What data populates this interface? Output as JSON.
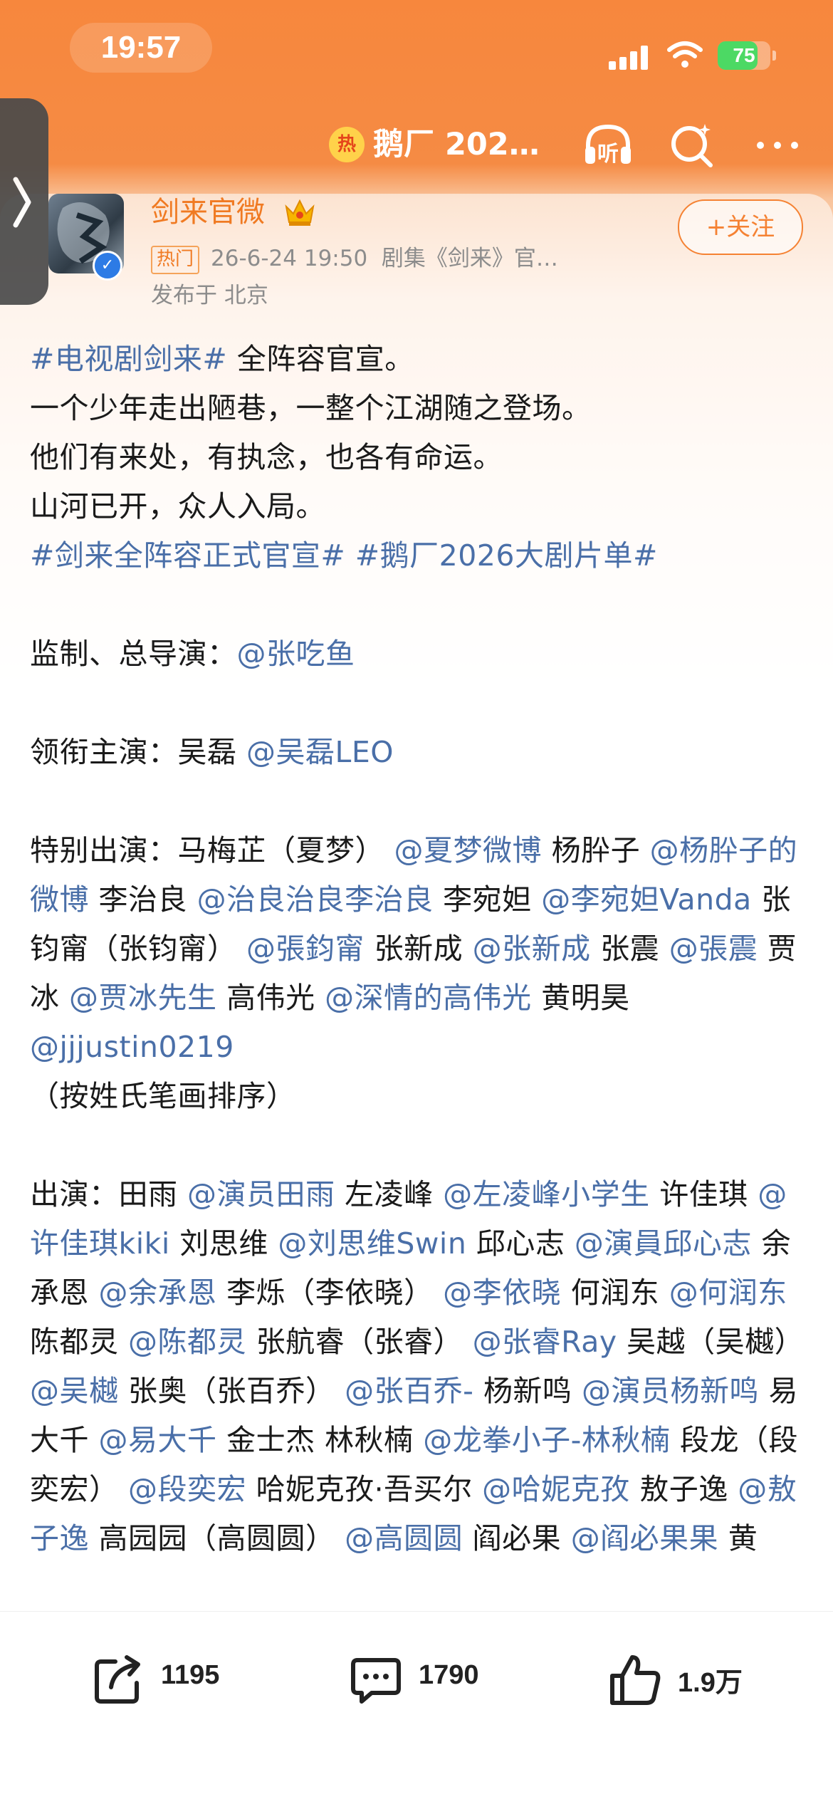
{
  "status_bar": {
    "time": "19:57",
    "battery": "75",
    "battery_level": 0.75
  },
  "nav": {
    "hot_badge": "热",
    "title": "鹅厂 202…",
    "listen_label": "听"
  },
  "post_header": {
    "username": "剑来官微",
    "follow_label": "+关注",
    "hot_tag": "热门",
    "timestamp": "26-6-24 19:50",
    "source": "剧集《剑来》官…",
    "location": "发布于 北京"
  },
  "post": {
    "p1": {
      "tag1": "#电视剧剑来#",
      "text1": " 全阵容官宣。",
      "line2": "一个少年走出陋巷，一整个江湖随之登场。",
      "line3": "他们有来处，有执念，也各有命运。",
      "line4": "山河已开，众人入局。",
      "tag2": "#剑来全阵容正式官宣#",
      "tag3": "#鹅厂2026大剧片单#"
    },
    "director": {
      "label": "监制、总导演：",
      "mention": "@张吃鱼"
    },
    "lead": {
      "label": "领衔主演：",
      "name": "吴磊 ",
      "mention": "@吴磊LEO"
    },
    "special": {
      "label": "特别出演：",
      "segments": [
        {
          "t": "马梅芷（夏梦）",
          "m": "@夏梦微博"
        },
        {
          "t": "杨肸子",
          "m": "@杨肸子的微博"
        },
        {
          "t": "李治良",
          "m": "@治良治良李治良"
        },
        {
          "t": "李宛妲",
          "m": "@李宛妲Vanda"
        },
        {
          "t": "张钧甯（张钧甯）",
          "m": "@張鈞甯"
        },
        {
          "t": "张新成",
          "m": "@张新成"
        },
        {
          "t": "张震",
          "m": "@張震"
        },
        {
          "t": "贾冰",
          "m": "@贾冰先生"
        },
        {
          "t": "高伟光",
          "m": "@深情的高伟光"
        },
        {
          "t": "黄明昊",
          "m": "@jjjustin0219"
        }
      ],
      "note": "（按姓氏笔画排序）"
    },
    "cast": {
      "label": "出演：",
      "segments": [
        {
          "t": "田雨",
          "m": "@演员田雨"
        },
        {
          "t": "左凌峰",
          "m": "@左凌峰小学生"
        },
        {
          "t": "许佳琪",
          "m": "@许佳琪kiki"
        },
        {
          "t": "刘思维",
          "m": "@刘思维Swin"
        },
        {
          "t": "邱心志",
          "m": "@演員邱心志"
        },
        {
          "t": "余承恩",
          "m": "@余承恩"
        },
        {
          "t": "李烁（李依晓）",
          "m": "@李依晓"
        },
        {
          "t": "何润东",
          "m": "@何润东"
        },
        {
          "t": "陈都灵",
          "m": "@陈都灵"
        },
        {
          "t": "张航睿（张睿）",
          "m": "@张睿Ray"
        },
        {
          "t": "吴越（吴樾）",
          "m": "@吴樾"
        },
        {
          "t": "张奥（张百乔）",
          "m": "@张百乔-"
        },
        {
          "t": "杨新鸣",
          "m": "@演员杨新鸣"
        },
        {
          "t": "易大千",
          "m": "@易大千"
        },
        {
          "t": "金士杰",
          "m": ""
        },
        {
          "t": "林秋楠",
          "m": "@龙拳小子-林秋楠"
        },
        {
          "t": "段龙（段奕宏）",
          "m": "@段奕宏"
        },
        {
          "t": "哈妮克孜·吾买尔",
          "m": "@哈妮克孜"
        },
        {
          "t": "敖子逸",
          "m": "@敖子逸"
        },
        {
          "t": "高园园（高圆圆）",
          "m": "@高圆圆"
        },
        {
          "t": "阎必果",
          "m": "@阎必果果"
        },
        {
          "t": "黄",
          "m": ""
        }
      ]
    }
  },
  "actions": {
    "repost_count": "1195",
    "comment_count": "1790",
    "like_count": "1.9万"
  },
  "colors": {
    "accent": "#f58233",
    "link": "#4a6fa8",
    "header_orange": "#f7873d"
  }
}
